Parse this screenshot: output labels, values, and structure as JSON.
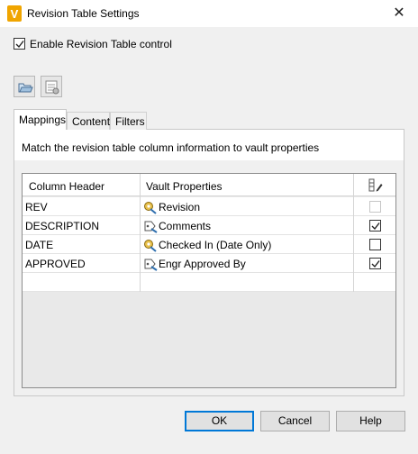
{
  "window": {
    "title": "Revision Table Settings",
    "close_glyph": "✕",
    "app_icon": "vault-v-logo",
    "app_icon_letter": "V"
  },
  "enable_control": {
    "label": "Enable Revision Table control",
    "checked": true
  },
  "toolbar": {
    "buttons": [
      {
        "icon": "open-folder-icon"
      },
      {
        "icon": "table-settings-icon"
      }
    ]
  },
  "tabs": [
    {
      "label": "Mappings",
      "active": true
    },
    {
      "label": "Content",
      "active": false
    },
    {
      "label": "Filters",
      "active": false
    }
  ],
  "mappings": {
    "instruction": "Match the revision table column information to vault properties",
    "columns": {
      "column_header": "Column Header",
      "vault_properties": "Vault Properties",
      "edit_icon": "column-edit-icon"
    },
    "rows": [
      {
        "header": "REV",
        "property": "Revision",
        "icon": "system-property-icon",
        "checked": false,
        "disabled": true
      },
      {
        "header": "DESCRIPTION",
        "property": "Comments",
        "icon": "user-property-icon",
        "checked": true,
        "disabled": false
      },
      {
        "header": "DATE",
        "property": "Checked In (Date Only)",
        "icon": "system-property-icon",
        "checked": false,
        "disabled": false
      },
      {
        "header": "APPROVED",
        "property": "Engr Approved By",
        "icon": "user-property-icon",
        "checked": true,
        "disabled": false
      }
    ]
  },
  "buttons": {
    "ok": "OK",
    "cancel": "Cancel",
    "help": "Help"
  },
  "colors": {
    "accent": "#0078d7",
    "vault_logo": "#f0a500"
  }
}
